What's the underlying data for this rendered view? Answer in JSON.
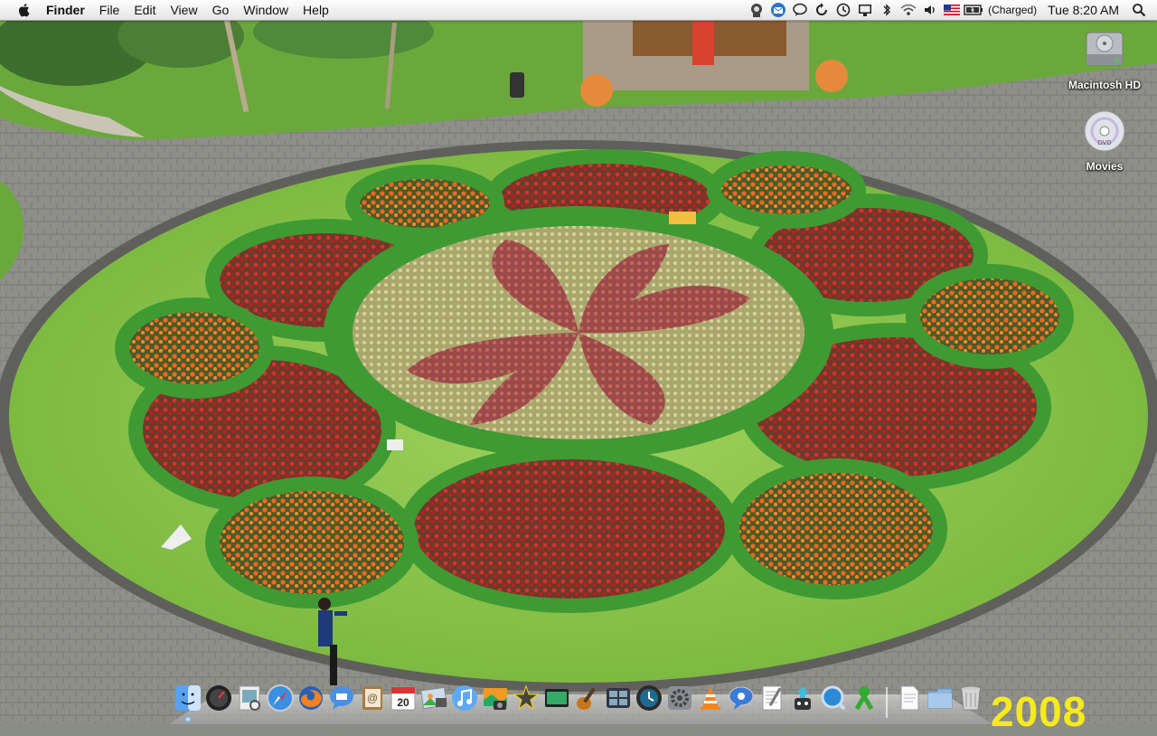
{
  "menubar": {
    "apple_menu": "apple-icon",
    "app_name": "Finder",
    "menus": [
      "File",
      "Edit",
      "View",
      "Go",
      "Window",
      "Help"
    ],
    "status": {
      "icons": [
        "robot-icon",
        "envelope-icon",
        "chat-bubble-icon",
        "sync-icon",
        "time-machine-icon",
        "display-icon",
        "bluetooth-icon",
        "wifi-icon",
        "volume-icon",
        "us-flag-icon",
        "battery-icon"
      ],
      "battery_text": "(Charged)",
      "clock": "Tue 8:20 AM",
      "search_icon": "spotlight-icon"
    }
  },
  "desktop": {
    "icons": [
      {
        "label": "Macintosh HD",
        "icon": "hard-drive-icon"
      },
      {
        "label": "Movies",
        "icon": "dvd-disc-icon"
      }
    ],
    "wallpaper_text": "2008"
  },
  "dock": {
    "apps": [
      {
        "name": "Finder",
        "icon": "finder-icon",
        "running": true
      },
      {
        "name": "Dashboard",
        "icon": "dashboard-icon",
        "running": false
      },
      {
        "name": "Preview",
        "icon": "preview-icon",
        "running": false
      },
      {
        "name": "Safari",
        "icon": "safari-icon",
        "running": false
      },
      {
        "name": "Firefox",
        "icon": "firefox-icon",
        "running": false
      },
      {
        "name": "iChat",
        "icon": "ichat-icon",
        "running": false
      },
      {
        "name": "Address Book",
        "icon": "address-book-icon",
        "running": false
      },
      {
        "name": "iCal",
        "icon": "ical-icon",
        "running": false,
        "badge_text": "20"
      },
      {
        "name": "iPhoto",
        "icon": "iphoto-icon",
        "running": false
      },
      {
        "name": "iTunes",
        "icon": "itunes-icon",
        "running": false
      },
      {
        "name": "Photo Booth",
        "icon": "photo-booth-icon",
        "running": false
      },
      {
        "name": "iMovie",
        "icon": "imovie-icon",
        "running": false
      },
      {
        "name": "Front Row",
        "icon": "front-row-icon",
        "running": false
      },
      {
        "name": "GarageBand",
        "icon": "garageband-icon",
        "running": false
      },
      {
        "name": "Spaces",
        "icon": "spaces-icon",
        "running": false
      },
      {
        "name": "Time Machine",
        "icon": "time-machine-dock-icon",
        "running": false
      },
      {
        "name": "System Preferences",
        "icon": "system-preferences-icon",
        "running": false
      },
      {
        "name": "VLC",
        "icon": "vlc-icon",
        "running": false
      },
      {
        "name": "Messenger",
        "icon": "messenger-icon",
        "running": false
      },
      {
        "name": "TextEdit",
        "icon": "textedit-icon",
        "running": false
      },
      {
        "name": "Uploader",
        "icon": "upload-robot-icon",
        "running": false
      },
      {
        "name": "QuickTime",
        "icon": "quicktime-icon",
        "running": false
      },
      {
        "name": "Growl",
        "icon": "growl-icon",
        "running": false
      }
    ],
    "right": [
      {
        "name": "Document",
        "icon": "document-icon"
      },
      {
        "name": "Documents Folder",
        "icon": "folder-icon"
      },
      {
        "name": "Trash",
        "icon": "trash-icon"
      }
    ]
  },
  "colors": {
    "grass": "#86c24a",
    "hedge": "#3f9a33",
    "red_flowers": "#b92a2a",
    "orange_flowers": "#f0661f",
    "pavement": "#8b8c86",
    "running_light": "#4fa6ff"
  }
}
